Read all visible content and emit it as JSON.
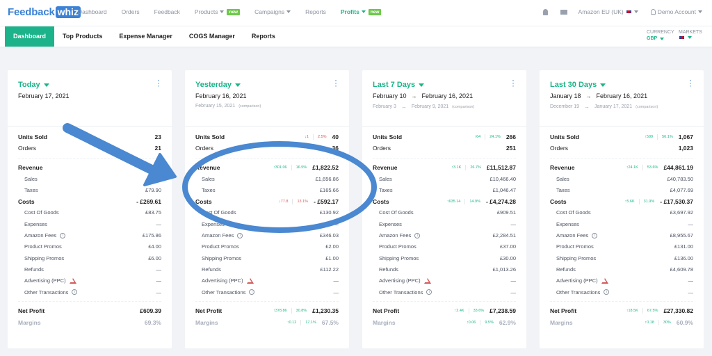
{
  "app": {
    "logo": {
      "part1": "Feedback",
      "part2": "whiz"
    },
    "nav": [
      {
        "label": "Dashboard",
        "has_caret": false,
        "badge": null,
        "active": false
      },
      {
        "label": "Orders",
        "has_caret": false,
        "badge": null,
        "active": false
      },
      {
        "label": "Feedback",
        "has_caret": false,
        "badge": null,
        "active": false
      },
      {
        "label": "Products",
        "has_caret": true,
        "badge": "new",
        "active": false
      },
      {
        "label": "Campaigns",
        "has_caret": true,
        "badge": null,
        "active": false
      },
      {
        "label": "Reports",
        "has_caret": false,
        "badge": null,
        "active": false
      },
      {
        "label": "Profits",
        "has_caret": true,
        "badge": "new",
        "active": true
      }
    ],
    "marketplace": "Amazon EU (UK)",
    "account": "Demo Account"
  },
  "subnav": {
    "tabs": [
      {
        "label": "Dashboard",
        "active": true
      },
      {
        "label": "Top Products",
        "active": false
      },
      {
        "label": "Expense Manager",
        "active": false
      },
      {
        "label": "COGS Manager",
        "active": false
      },
      {
        "label": "Reports",
        "active": false
      }
    ],
    "currency_label": "CURRENCY",
    "currency_value": "GBP",
    "markets_label": "MARKETS"
  },
  "labels": {
    "units_sold": "Units Sold",
    "orders": "Orders",
    "revenue": "Revenue",
    "sales": "Sales",
    "taxes": "Taxes",
    "costs": "Costs",
    "cost_of_goods": "Cost Of Goods",
    "expenses": "Expenses",
    "amazon_fees": "Amazon Fees",
    "product_promos": "Product Promos",
    "shipping_promos": "Shipping Promos",
    "refunds": "Refunds",
    "advertising": "Advertising (PPC)",
    "other_transactions": "Other Transactions",
    "net_profit": "Net Profit",
    "margins": "Margins",
    "comparison": "(comparison)",
    "arrow": "→"
  },
  "cards": [
    {
      "period": "Today",
      "date_from": "February 17, 2021",
      "date_to": null,
      "cmp_from": null,
      "cmp_to": null,
      "units_sold": {
        "value": "23",
        "delta": null
      },
      "orders": {
        "value": "21"
      },
      "revenue": {
        "value": "£1,…",
        "delta": null
      },
      "sales": "£…",
      "taxes": "£79.90",
      "costs": {
        "value": "- £269.61",
        "delta": null
      },
      "cost_of_goods": "£83.75",
      "expenses": "—",
      "amazon_fees": "£175.86",
      "product_promos": "£4.00",
      "shipping_promos": "£6.00",
      "refunds": "—",
      "advertising": "—",
      "other_transactions": "—",
      "net_profit": {
        "value": "£609.39",
        "delta": null
      },
      "margins": {
        "value": "69.3%",
        "delta": null
      }
    },
    {
      "period": "Yesterday",
      "date_from": "February 16, 2021",
      "date_to": null,
      "cmp_from": "February 15, 2021",
      "cmp_to": null,
      "units_sold": {
        "value": "40",
        "delta": {
          "dir": "down",
          "abs": "1",
          "pct": "2.5%"
        }
      },
      "orders": {
        "value": "36"
      },
      "revenue": {
        "value": "£1,822.52",
        "delta": {
          "dir": "up",
          "abs": "301.06",
          "pct": "16.5%"
        }
      },
      "sales": "£1,656.86",
      "taxes": "£165.66",
      "costs": {
        "value": "- £592.17",
        "delta": {
          "dir": "down",
          "abs": "77.8",
          "pct": "13.1%"
        }
      },
      "cost_of_goods": "£130.92",
      "expenses": "—",
      "amazon_fees": "£346.03",
      "product_promos": "£2.00",
      "shipping_promos": "£1.00",
      "refunds": "£112.22",
      "advertising": "—",
      "other_transactions": "—",
      "net_profit": {
        "value": "£1,230.35",
        "delta": {
          "dir": "up",
          "abs": "378.86",
          "pct": "30.8%"
        }
      },
      "margins": {
        "value": "67.5%",
        "delta": {
          "dir": "up",
          "abs": "0.12",
          "pct": "17.1%"
        }
      }
    },
    {
      "period": "Last 7 Days",
      "date_from": "February 10",
      "date_to": "February 16, 2021",
      "cmp_from": "February 3",
      "cmp_to": "February 9, 2021",
      "units_sold": {
        "value": "266",
        "delta": {
          "dir": "up",
          "abs": "64",
          "pct": "24.1%"
        }
      },
      "orders": {
        "value": "251"
      },
      "revenue": {
        "value": "£11,512.87",
        "delta": {
          "dir": "up",
          "abs": "3.1K",
          "pct": "26.7%"
        }
      },
      "sales": "£10,466.40",
      "taxes": "£1,046.47",
      "costs": {
        "value": "- £4,274.28",
        "delta": {
          "dir": "up",
          "abs": "635.14",
          "pct": "14.9%"
        }
      },
      "cost_of_goods": "£909.51",
      "expenses": "—",
      "amazon_fees": "£2,284.51",
      "product_promos": "£37.00",
      "shipping_promos": "£30.00",
      "refunds": "£1,013.26",
      "advertising": "—",
      "other_transactions": "—",
      "net_profit": {
        "value": "£7,238.59",
        "delta": {
          "dir": "up",
          "abs": "2.4K",
          "pct": "33.6%"
        }
      },
      "margins": {
        "value": "62.9%",
        "delta": {
          "dir": "up",
          "abs": "0.06",
          "pct": "9.5%"
        }
      }
    },
    {
      "period": "Last 30 Days",
      "date_from": "January 18",
      "date_to": "February 16, 2021",
      "cmp_from": "December 19",
      "cmp_to": "January 17, 2021",
      "units_sold": {
        "value": "1,067",
        "delta": {
          "dir": "up",
          "abs": "599",
          "pct": "56.1%"
        }
      },
      "orders": {
        "value": "1,023"
      },
      "revenue": {
        "value": "£44,861.19",
        "delta": {
          "dir": "up",
          "abs": "24.1K",
          "pct": "53.6%"
        }
      },
      "sales": "£40,783.50",
      "taxes": "£4,077.69",
      "costs": {
        "value": "- £17,530.37",
        "delta": {
          "dir": "up",
          "abs": "5.6K",
          "pct": "31.9%"
        }
      },
      "cost_of_goods": "£3,697.92",
      "expenses": "—",
      "amazon_fees": "£8,955.67",
      "product_promos": "£131.00",
      "shipping_promos": "£136.00",
      "refunds": "£4,609.78",
      "advertising": "—",
      "other_transactions": "—",
      "net_profit": {
        "value": "£27,330.82",
        "delta": {
          "dir": "up",
          "abs": "18.5K",
          "pct": "67.5%"
        }
      },
      "margins": {
        "value": "60.9%",
        "delta": {
          "dir": "up",
          "abs": "0.18",
          "pct": "30%"
        }
      }
    }
  ],
  "colors": {
    "accent": "#1db38a",
    "logo_blue": "#3b82d6",
    "up": "#1db38a",
    "down": "#d25a5a",
    "annotation": "#4a88d1",
    "background": "#f1f3f6"
  }
}
